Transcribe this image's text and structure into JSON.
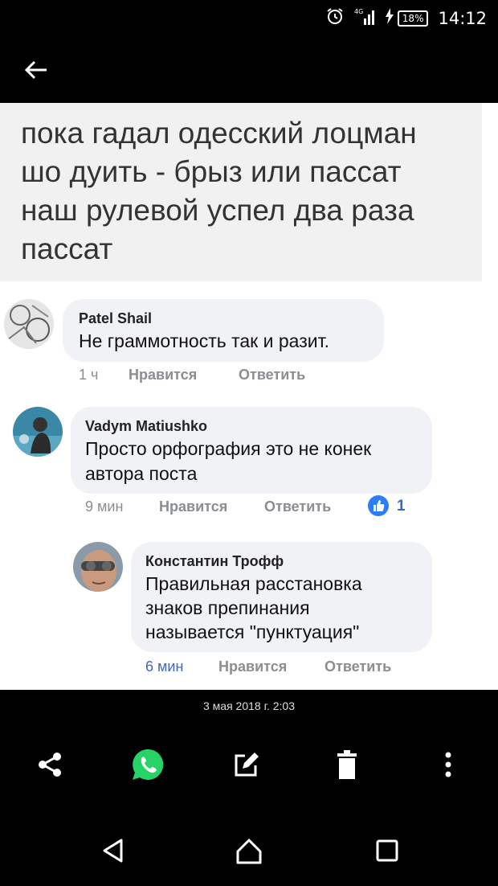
{
  "status_bar": {
    "battery": "18%",
    "time": "14:12"
  },
  "post": {
    "lines": [
      "пока гадал одесский лоцман",
      "шо дуить -  брыз или пассат",
      "наш рулевой успел два раза",
      "пассат"
    ]
  },
  "comments": [
    {
      "author": "Patel Shail",
      "text": [
        "Не граммотность так и разит."
      ],
      "time": "1 ч",
      "like": "Нравится",
      "reply": "Ответить"
    },
    {
      "author": "Vadym Matiushko",
      "text": [
        "Просто орфография это не конек",
        "автора поста"
      ],
      "time": "9 мин",
      "like": "Нравится",
      "reply": "Ответить",
      "reactions": "1"
    },
    {
      "author": "Константин Трофф",
      "text": [
        "Правильная расстановка",
        "знаков препинания",
        "называется \"пунктуация\""
      ],
      "time": "6 мин",
      "like": "Нравится",
      "reply": "Ответить"
    }
  ],
  "date": "3 мая 2018 г. 2:03"
}
